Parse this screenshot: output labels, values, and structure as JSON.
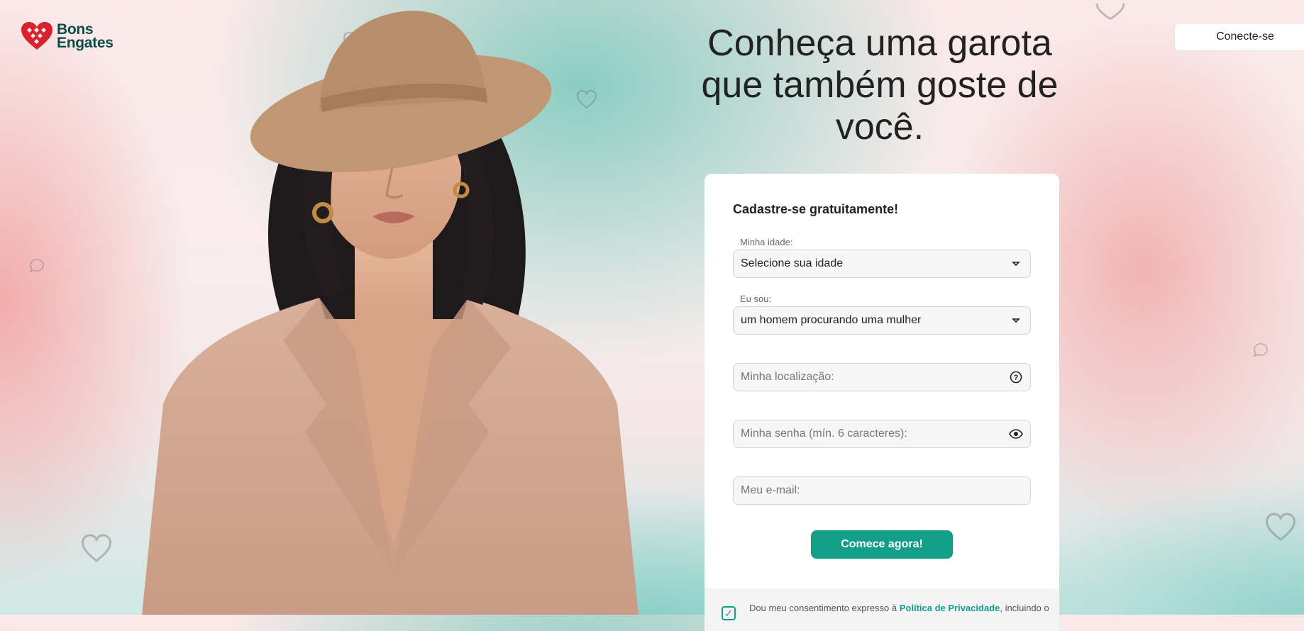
{
  "brand": {
    "line1": "Bons",
    "line2": "Engates",
    "color": "#0d4b47",
    "heart_color": "#d8232f"
  },
  "header": {
    "login_label": "Conecte-se"
  },
  "hero": {
    "headline": "Conheça uma garota que também goste de você."
  },
  "form": {
    "title": "Cadastre-se gratuitamente!",
    "age": {
      "label": "Minha idade:",
      "value": "Selecione sua idade",
      "icon": "chevron-down-icon"
    },
    "iam": {
      "label": "Eu sou:",
      "value": "um homem procurando uma mulher",
      "icon": "chevron-down-icon"
    },
    "location": {
      "placeholder": "Minha localização:",
      "icon": "help-icon"
    },
    "password": {
      "placeholder": "Minha senha (mín. 6 caracteres):",
      "icon": "eye-icon"
    },
    "email": {
      "placeholder": "Meu e-mail:"
    },
    "submit_label": "Comece agora!",
    "accent": "#139e8a"
  },
  "consent": {
    "checked": true,
    "text_before": "Dou meu consentimento expresso à ",
    "link_label": "Política de Privacidade",
    "text_after": ", incluindo o"
  }
}
